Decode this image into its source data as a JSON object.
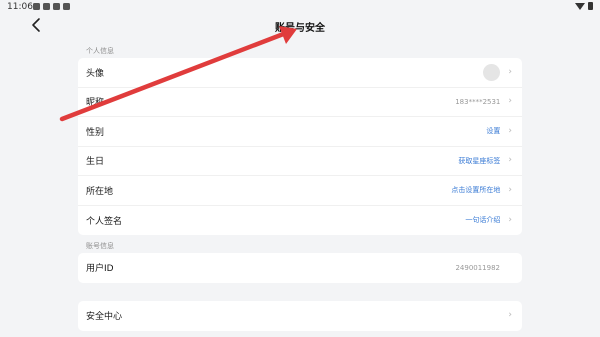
{
  "status": {
    "time": "11:06"
  },
  "header": {
    "title": "账号与安全"
  },
  "sections": {
    "personal": "个人信息",
    "account": "账号信息"
  },
  "personal_rows": [
    {
      "label": "头像"
    },
    {
      "label": "昵称",
      "value": "183****2531"
    },
    {
      "label": "性别",
      "value": "设置"
    },
    {
      "label": "生日",
      "value": "获取星座标签"
    },
    {
      "label": "所在地",
      "value": "点击设置所在地"
    },
    {
      "label": "个人签名",
      "value": "一句话介绍"
    }
  ],
  "account_rows": [
    {
      "label": "用户ID",
      "value": "2490011982"
    }
  ],
  "security_rows": [
    {
      "label": "安全中心"
    }
  ],
  "colors": {
    "link": "#3a7bd5",
    "annotation_arrow": "#e03c3c"
  },
  "icons": [
    "back-arrow-icon",
    "chevron-right-icon",
    "wifi-icon",
    "battery-icon"
  ]
}
